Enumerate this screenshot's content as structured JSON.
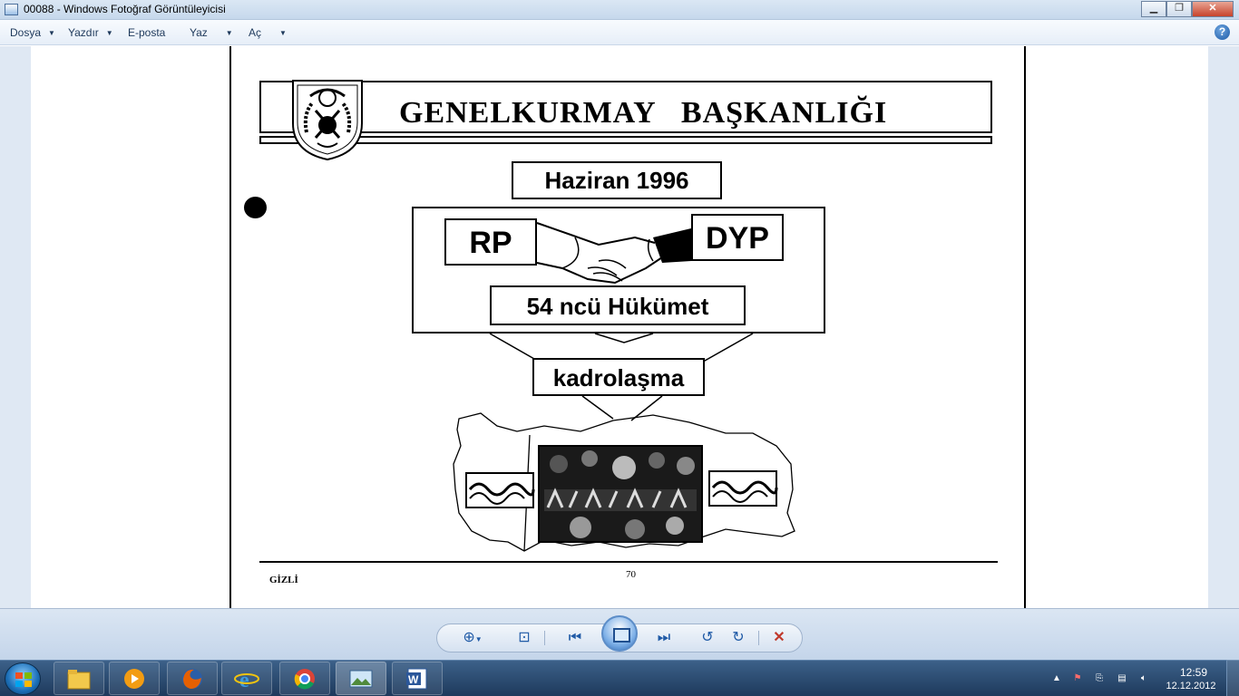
{
  "window": {
    "title": "00088 - Windows Fotoğraf Görüntüleyicisi"
  },
  "menu": {
    "items": [
      {
        "label": "Dosya",
        "has_dropdown": true
      },
      {
        "label": "Yazdır",
        "has_dropdown": true
      },
      {
        "label": "E-posta",
        "has_dropdown": false
      },
      {
        "label": "Yaz",
        "has_dropdown": true
      },
      {
        "label": "Aç",
        "has_dropdown": true
      }
    ],
    "help_label": "?"
  },
  "document": {
    "title": "GENELKURMAY   BAŞKANLIĞI",
    "date": "Haziran 1996",
    "party_left": "RP",
    "party_right": "DYP",
    "government": "54 ncü Hükümet",
    "process": "kadrolaşma",
    "footer_classification": "GİZLİ",
    "page_number": "70"
  },
  "viewer_toolbar": {
    "buttons": [
      "zoom-icon",
      "fit-window-icon",
      "previous-icon",
      "slideshow-icon",
      "next-icon",
      "rotate-left-icon",
      "rotate-right-icon",
      "delete-icon"
    ]
  },
  "taskbar": {
    "apps": [
      "file-explorer-icon",
      "media-player-icon",
      "firefox-icon",
      "internet-explorer-icon",
      "chrome-icon",
      "photo-viewer-icon",
      "word-icon"
    ],
    "clock_time": "12:59",
    "clock_date": "12.12.2012"
  },
  "colors": {
    "titlebar": "#c6d8ec",
    "taskbar": "#1e3a5c",
    "close_button": "#c7432b",
    "delete_icon": "#c0392b"
  }
}
